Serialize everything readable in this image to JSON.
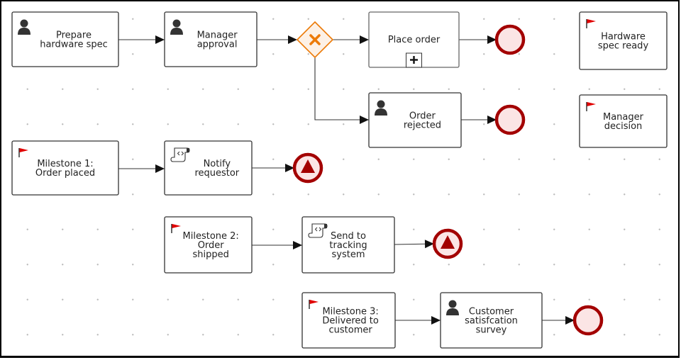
{
  "diagram": {
    "type": "BPMN process",
    "colors": {
      "task_border": "#333333",
      "end_event": "#a30000",
      "end_event_fill": "#fbe5e5",
      "gateway": "#ec7a08",
      "gateway_fill": "#fdf1e6",
      "milestone_flag": "#e00000"
    },
    "nodes": [
      {
        "id": "prepare_spec",
        "kind": "user-task",
        "icon": "user-icon",
        "lines": [
          "Prepare",
          "hardware spec"
        ]
      },
      {
        "id": "manager_approval",
        "kind": "user-task",
        "icon": "user-icon",
        "lines": [
          "Manager",
          "approval"
        ]
      },
      {
        "id": "approval_gateway",
        "kind": "exclusive-gateway",
        "icon": "x-icon",
        "lines": []
      },
      {
        "id": "place_order",
        "kind": "subprocess",
        "icon": "plus-icon",
        "lines": [
          "Place order"
        ]
      },
      {
        "id": "end_place_order",
        "kind": "end-event",
        "lines": []
      },
      {
        "id": "order_rejected",
        "kind": "user-task",
        "icon": "user-icon",
        "lines": [
          "Order",
          "rejected"
        ]
      },
      {
        "id": "end_rejected",
        "kind": "end-event",
        "lines": []
      },
      {
        "id": "hw_spec_ready",
        "kind": "milestone",
        "icon": "flag-icon",
        "lines": [
          "Hardware",
          "spec ready"
        ]
      },
      {
        "id": "manager_decision",
        "kind": "milestone",
        "icon": "flag-icon",
        "lines": [
          "Manager",
          "decision"
        ]
      },
      {
        "id": "milestone1",
        "kind": "milestone",
        "icon": "flag-icon",
        "lines": [
          "Milestone 1:",
          "Order placed"
        ]
      },
      {
        "id": "notify_requestor",
        "kind": "script-task",
        "icon": "script-icon",
        "lines": [
          "Notify",
          "requestor"
        ]
      },
      {
        "id": "end_escalate1",
        "kind": "escalation-end-event",
        "icon": "escalation-icon",
        "lines": []
      },
      {
        "id": "milestone2",
        "kind": "milestone",
        "icon": "flag-icon",
        "lines": [
          "Milestone 2:",
          "Order",
          "shipped"
        ]
      },
      {
        "id": "send_tracking",
        "kind": "script-task",
        "icon": "script-icon",
        "lines": [
          "Send to",
          "tracking",
          "system"
        ]
      },
      {
        "id": "end_escalate2",
        "kind": "escalation-end-event",
        "icon": "escalation-icon",
        "lines": []
      },
      {
        "id": "milestone3",
        "kind": "milestone",
        "icon": "flag-icon",
        "lines": [
          "Milestone 3:",
          "Delivered to",
          "customer"
        ]
      },
      {
        "id": "customer_survey",
        "kind": "user-task",
        "icon": "user-icon",
        "lines": [
          "Customer",
          "satisfcation",
          "survey"
        ]
      },
      {
        "id": "end_survey",
        "kind": "end-event",
        "lines": []
      }
    ],
    "edges": [
      {
        "from": "prepare_spec",
        "to": "manager_approval"
      },
      {
        "from": "manager_approval",
        "to": "approval_gateway"
      },
      {
        "from": "approval_gateway",
        "to": "place_order"
      },
      {
        "from": "approval_gateway",
        "to": "order_rejected"
      },
      {
        "from": "place_order",
        "to": "end_place_order"
      },
      {
        "from": "order_rejected",
        "to": "end_rejected"
      },
      {
        "from": "milestone1",
        "to": "notify_requestor"
      },
      {
        "from": "notify_requestor",
        "to": "end_escalate1"
      },
      {
        "from": "milestone2",
        "to": "send_tracking"
      },
      {
        "from": "send_tracking",
        "to": "end_escalate2"
      },
      {
        "from": "milestone3",
        "to": "customer_survey"
      },
      {
        "from": "customer_survey",
        "to": "end_survey"
      }
    ]
  }
}
